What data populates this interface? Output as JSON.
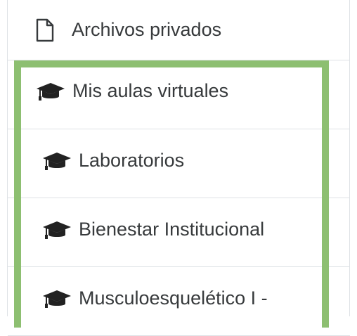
{
  "menu": {
    "top_item": {
      "label": "Archivos privados",
      "icon": "file-icon"
    },
    "courses_header": {
      "label": "Mis aulas virtuales",
      "icon": "graduation-cap-icon"
    },
    "courses": [
      {
        "label": "Laboratorios",
        "icon": "graduation-cap-icon"
      },
      {
        "label": "Bienestar Institucional",
        "icon": "graduation-cap-icon"
      },
      {
        "label": "Musculoesquelético I -",
        "icon": "graduation-cap-icon"
      }
    ]
  },
  "colors": {
    "highlight": "#8dbf71",
    "text": "#373a3c",
    "divider": "#dee2e6"
  }
}
